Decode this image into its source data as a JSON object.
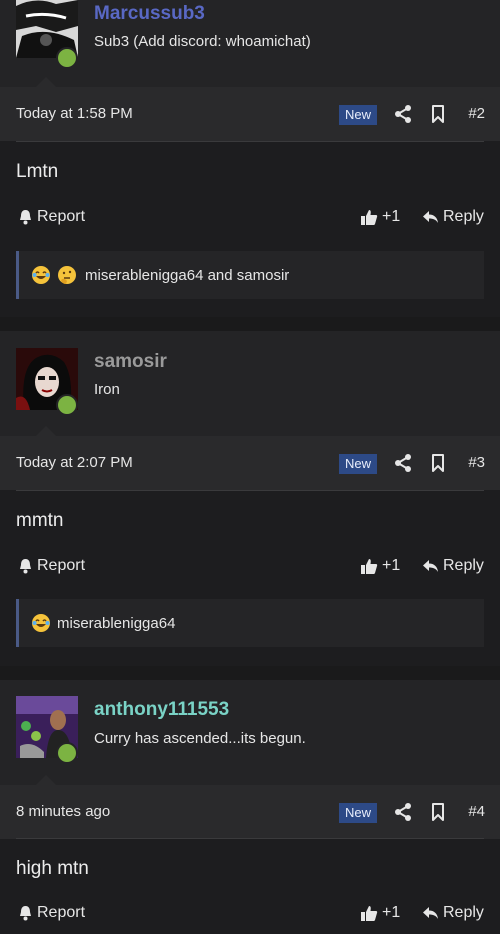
{
  "posts": [
    {
      "username": "Marcussub3",
      "username_color": "#5968c4",
      "user_title": "Sub3 (Add discord: whoamichat)",
      "time": "Today at 1:58 PM",
      "badge": "New",
      "number": "#2",
      "body": "Lmtn",
      "report": "Report",
      "like": "+1",
      "reply": "Reply",
      "reactions": "miserablenigga64 and samosir",
      "reaction_icons": [
        "joy-emoji-icon",
        "thinking-emoji-icon"
      ]
    },
    {
      "username": "samosir",
      "username_color": "#9a9a9a",
      "user_title": "Iron",
      "time": "Today at 2:07 PM",
      "badge": "New",
      "number": "#3",
      "body": "mmtn",
      "report": "Report",
      "like": "+1",
      "reply": "Reply",
      "reactions": "miserablenigga64",
      "reaction_icons": [
        "joy-emoji-icon"
      ]
    },
    {
      "username": "anthony111553",
      "username_color": "#7ad3c6",
      "user_title": "Curry has ascended...its begun.",
      "time": "8 minutes ago",
      "badge": "New",
      "number": "#4",
      "body": "high mtn",
      "report": "Report",
      "like": "+1",
      "reply": "Reply"
    }
  ]
}
